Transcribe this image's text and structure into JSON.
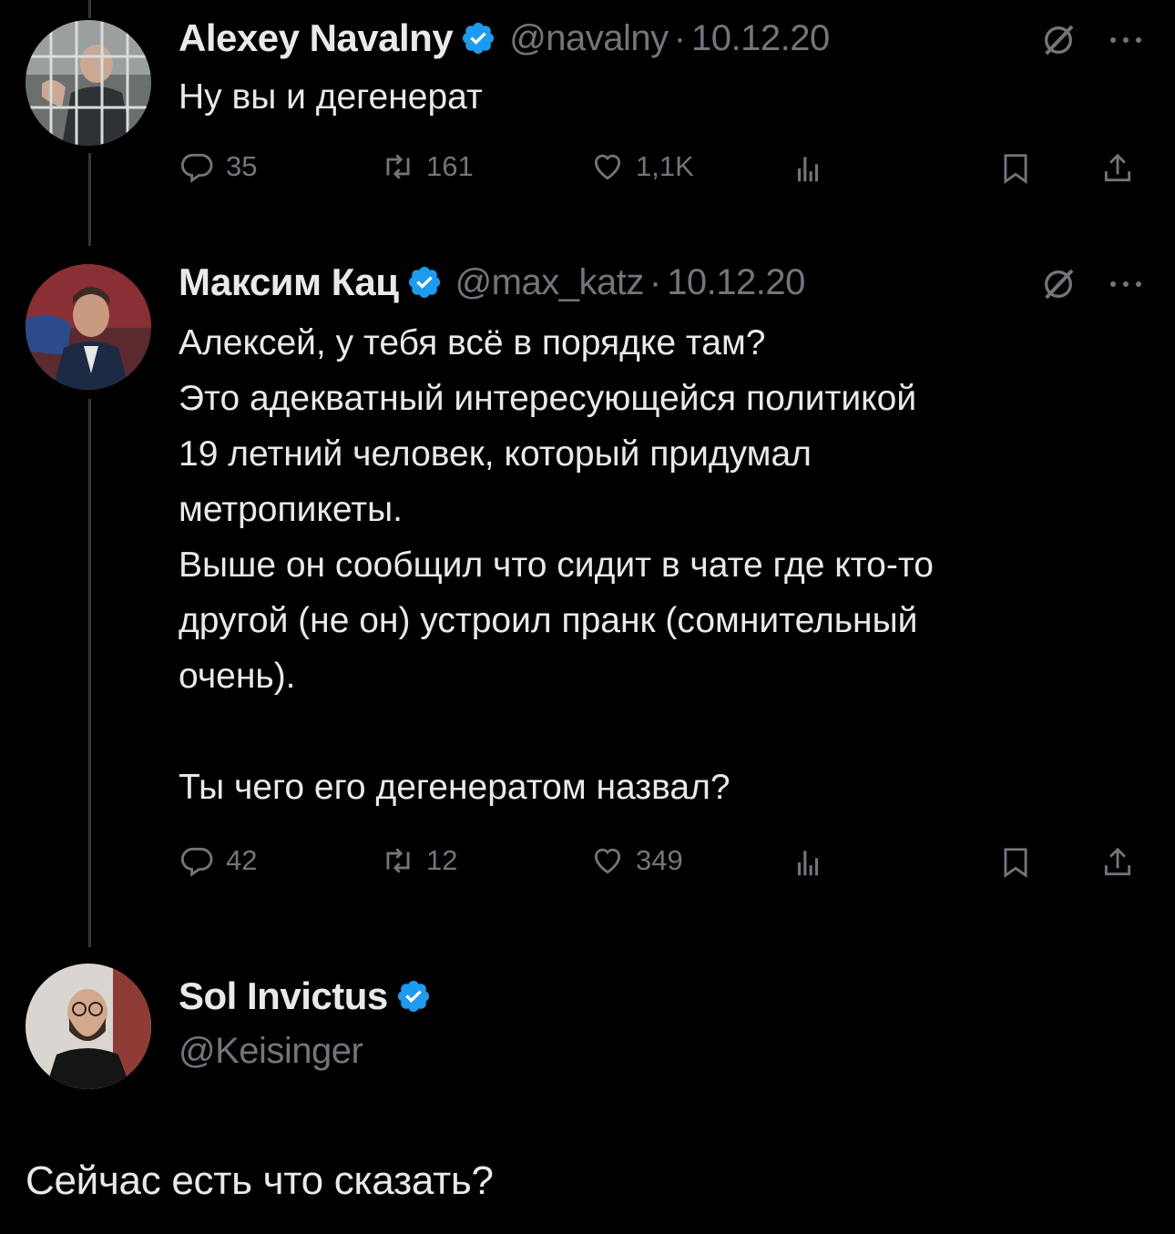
{
  "colors": {
    "background": "#000000",
    "text": "#e7e9ea",
    "muted": "#71767b",
    "verified": "#1d9bf0",
    "thread_line": "#333639"
  },
  "tweets": [
    {
      "name": "Alexey Navalny",
      "handle": "@navalny",
      "separator": "·",
      "date": "10.12.20",
      "text": "Ну вы и дегенерат",
      "replies": "35",
      "retweets": "161",
      "likes": "1,1K"
    },
    {
      "name": "Максим Кац",
      "handle": "@max_katz",
      "separator": "·",
      "date": "10.12.20",
      "text": "Алексей, у тебя всё в порядке там?\nЭто адекватный интересующейся политикой\n19 летний человек, который придумал\nметропикеты.\nВыше он сообщил что сидит в чате где кто-то\nдругой (не он) устроил пранк (сомнительный\nочень).\n\nТы чего его дегенератом назвал?",
      "replies": "42",
      "retweets": "12",
      "likes": "349"
    }
  ],
  "main_post": {
    "name": "Sol Invictus",
    "handle": "@Keisinger",
    "text": "Сейчас есть что сказать?"
  },
  "icons": [
    "verified-badge-icon",
    "grok-icon",
    "more-icon",
    "reply-icon",
    "retweet-icon",
    "like-icon",
    "views-icon",
    "bookmark-icon",
    "share-icon"
  ]
}
